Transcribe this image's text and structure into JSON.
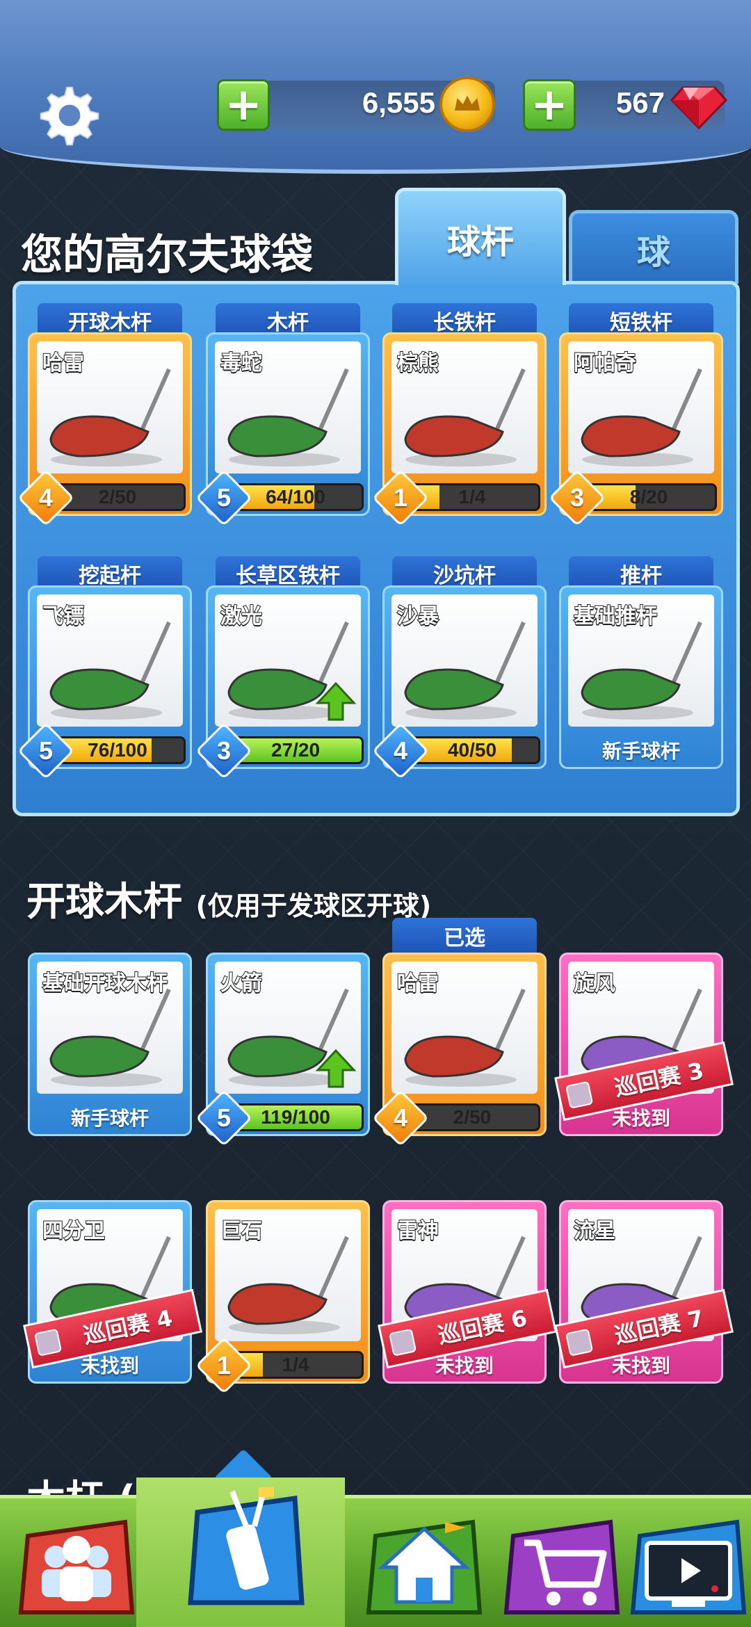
{
  "currency": {
    "coins": "6,555",
    "gems": "567",
    "plus": "+"
  },
  "bag": {
    "title": "您的高尔夫球袋",
    "tabs": [
      {
        "label": "球杆",
        "active": true
      },
      {
        "label": "球",
        "active": false
      }
    ],
    "slots": [
      {
        "category": "开球木杆",
        "club": "哈雷",
        "level": "4",
        "progress": "2/50",
        "fill": 0.04,
        "frame": "orange",
        "bar": "yellow"
      },
      {
        "category": "木杆",
        "club": "毒蛇",
        "level": "5",
        "progress": "64/100",
        "fill": 0.64,
        "frame": "blue",
        "bar": "yellow"
      },
      {
        "category": "长铁杆",
        "club": "棕熊",
        "level": "1",
        "progress": "1/4",
        "fill": 0.25,
        "frame": "orange",
        "bar": "yellow"
      },
      {
        "category": "短铁杆",
        "club": "阿帕奇",
        "level": "3",
        "progress": "8/20",
        "fill": 0.4,
        "frame": "orange",
        "bar": "yellow"
      },
      {
        "category": "挖起杆",
        "club": "飞镖",
        "level": "5",
        "progress": "76/100",
        "fill": 0.76,
        "frame": "blue",
        "bar": "yellow"
      },
      {
        "category": "长草区铁杆",
        "club": "激光",
        "level": "3",
        "progress": "27/20",
        "fill": 1.0,
        "frame": "blue",
        "bar": "green",
        "upgrade": true
      },
      {
        "category": "沙坑杆",
        "club": "沙暴",
        "level": "4",
        "progress": "40/50",
        "fill": 0.8,
        "frame": "blue",
        "bar": "yellow"
      },
      {
        "category": "推杆",
        "club": "基础推杆",
        "footer": "新手球杆",
        "frame": "blue"
      }
    ]
  },
  "drivers": {
    "title": "开球木杆",
    "subtitle": "(仅用于发球区开球)",
    "selected_label": "已选",
    "cards": [
      {
        "club": "基础开球木杆",
        "footer": "新手球杆",
        "frame": "blue"
      },
      {
        "club": "火箭",
        "level": "5",
        "progress": "119/100",
        "fill": 1.0,
        "frame": "blue",
        "bar": "green",
        "upgrade": true
      },
      {
        "club": "哈雷",
        "level": "4",
        "progress": "2/50",
        "fill": 0.04,
        "frame": "orange",
        "bar": "yellow",
        "selected": true
      },
      {
        "club": "旋风",
        "lock": "巡回赛 3",
        "footer": "未找到",
        "frame": "pink"
      },
      {
        "club": "四分卫",
        "lock": "巡回赛 4",
        "footer": "未找到",
        "frame": "blue"
      },
      {
        "club": "巨石",
        "level": "1",
        "progress": "1/4",
        "fill": 0.25,
        "frame": "orange",
        "bar": "yellow"
      },
      {
        "club": "雷神",
        "lock": "巡回赛 6",
        "footer": "未找到",
        "frame": "pink"
      },
      {
        "club": "流星",
        "lock": "巡回赛 7",
        "footer": "未找到",
        "frame": "pink"
      }
    ]
  },
  "next_section": {
    "title": "木杆 ("
  },
  "nav": [
    {
      "name": "clubs-social-icon"
    },
    {
      "name": "golf-bag-icon",
      "active": true
    },
    {
      "name": "home-icon"
    },
    {
      "name": "shop-cart-icon"
    },
    {
      "name": "tv-rec-icon"
    }
  ],
  "colors": {
    "orange_frame": "#f48c1a",
    "blue_frame": "#2e82d4",
    "pink_frame": "#d8338f",
    "green_button": "#4fb02a"
  }
}
